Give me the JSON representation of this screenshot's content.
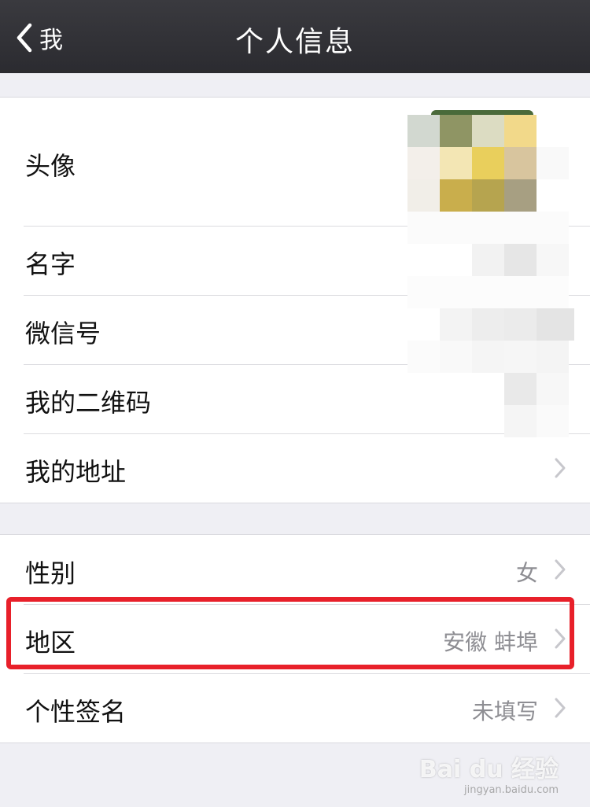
{
  "navbar": {
    "back_label": "我",
    "title": "个人信息"
  },
  "section1": {
    "avatar": "头像",
    "name": "名字",
    "wechat_id": "微信号",
    "qr_code": "我的二维码",
    "address": "我的地址"
  },
  "section2": {
    "gender_label": "性别",
    "gender_value": "女",
    "region_label": "地区",
    "region_value": "安徽 蚌埠",
    "signature_label": "个性签名",
    "signature_value": "未填写"
  },
  "watermark": {
    "main": "Bai du 经验",
    "sub": "jingyan.baidu.com"
  },
  "colors": {
    "navbar": "#2f2f34",
    "highlight": "#e8202a",
    "background": "#efeff4"
  }
}
